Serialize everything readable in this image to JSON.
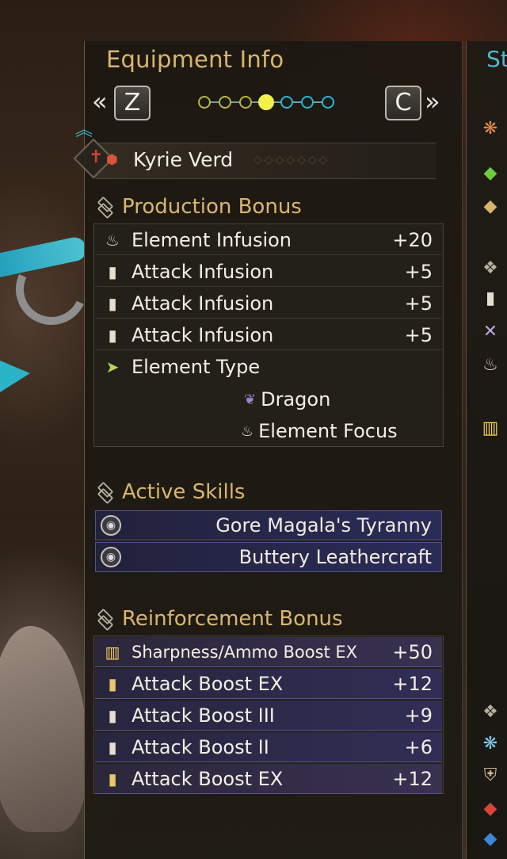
{
  "title": "Equipment Info",
  "nav": {
    "prev_key": "Z",
    "next_key": "C",
    "prev_arrow": "«",
    "next_arrow": "»",
    "dots": [
      {
        "color": "#b8b43c",
        "active": false
      },
      {
        "color": "#b8b43c",
        "active": false
      },
      {
        "color": "#b8b43c",
        "active": false
      },
      {
        "color": "#f2f04a",
        "active": true
      },
      {
        "color": "#2db6cf",
        "active": false
      },
      {
        "color": "#2db6cf",
        "active": false
      },
      {
        "color": "#2db6cf",
        "active": false
      }
    ]
  },
  "weapon": {
    "name": "Kyrie Verd",
    "icon": "long-sword-icon",
    "rarity_marker": "up-chevron-icon"
  },
  "production_bonus": {
    "header": "Production Bonus",
    "rows": [
      {
        "icon": "element-infusion-icon",
        "glyph": "♨",
        "name": "Element Infusion",
        "value": "+20"
      },
      {
        "icon": "attack-infusion-icon",
        "glyph": "▮",
        "name": "Attack Infusion",
        "value": "+5"
      },
      {
        "icon": "attack-infusion-icon",
        "glyph": "▮",
        "name": "Attack Infusion",
        "value": "+5"
      },
      {
        "icon": "attack-infusion-icon",
        "glyph": "▮",
        "name": "Attack Infusion",
        "value": "+5"
      },
      {
        "icon": "element-type-icon",
        "glyph": "➤",
        "name": "Element Type",
        "value": ""
      }
    ],
    "element_type": {
      "icon": "dragon-icon",
      "glyph": "❦",
      "value": "Dragon"
    },
    "element_focus": {
      "icon": "element-focus-icon",
      "glyph": "♨",
      "value": "Element Focus"
    }
  },
  "active_skills": {
    "header": "Active Skills",
    "items": [
      {
        "icon": "skill-decoration-icon",
        "name": "Gore Magala's Tyranny"
      },
      {
        "icon": "skill-decoration-icon",
        "name": "Buttery Leathercraft"
      }
    ]
  },
  "reinforcement_bonus": {
    "header": "Reinforcement Bonus",
    "rows": [
      {
        "icon": "sharpness-icon",
        "glyph": "▥",
        "name": "Sharpness/Ammo Boost EX",
        "value": "+50",
        "style": "purple-light"
      },
      {
        "icon": "attack-boost-ex-icon",
        "glyph": "▮",
        "name": "Attack Boost EX",
        "value": "+12",
        "style": "purple"
      },
      {
        "icon": "attack-boost-icon",
        "glyph": "▮",
        "name": "Attack Boost III",
        "value": "+9",
        "style": "purple"
      },
      {
        "icon": "attack-boost-icon",
        "glyph": "▮",
        "name": "Attack Boost II",
        "value": "+6",
        "style": "purple"
      },
      {
        "icon": "attack-boost-ex-icon",
        "glyph": "▮",
        "name": "Attack Boost EX",
        "value": "+12",
        "style": "purple-light"
      }
    ]
  },
  "right_panel": {
    "title_fragment": "St",
    "icons": [
      {
        "name": "orange-flower-icon",
        "glyph": "❋",
        "color": "#e08a44"
      },
      {
        "name": "green-gem-icon",
        "glyph": "◆",
        "color": "#6ccb3f"
      },
      {
        "name": "tan-gem-icon",
        "glyph": "◆",
        "color": "#d7b56d"
      },
      {
        "name": "stack-icon",
        "glyph": "❖",
        "color": "#b8b2a2"
      },
      {
        "name": "attack-icon",
        "glyph": "▮",
        "color": "#e6dfcf"
      },
      {
        "name": "crossed-swords-icon",
        "glyph": "✕",
        "color": "#b7a6e0"
      },
      {
        "name": "element-icon",
        "glyph": "♨",
        "color": "#d9d2c0"
      },
      {
        "name": "sharpness-icon",
        "glyph": "▥",
        "color": "#f0cf5a"
      },
      {
        "name": "stack-icon",
        "glyph": "❖",
        "color": "#b8b2a2"
      },
      {
        "name": "blue-flower-icon",
        "glyph": "❋",
        "color": "#7cc7e8"
      },
      {
        "name": "shield-icon",
        "glyph": "⛨",
        "color": "#c9b48a"
      },
      {
        "name": "red-gem-icon",
        "glyph": "◆",
        "color": "#d8443c"
      },
      {
        "name": "blue-gem-icon",
        "glyph": "◆",
        "color": "#3a86d8"
      }
    ]
  }
}
